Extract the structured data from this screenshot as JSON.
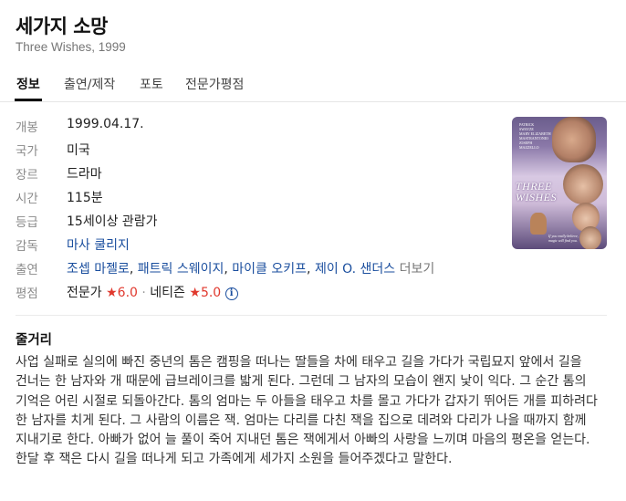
{
  "movie": {
    "title": "세가지 소망",
    "subtitle": "Three Wishes, 1999"
  },
  "tabs": [
    {
      "label": "정보",
      "active": true
    },
    {
      "label": "출연/제작",
      "active": false
    },
    {
      "label": "포토",
      "active": false
    },
    {
      "label": "전문가평점",
      "active": false
    }
  ],
  "info": {
    "release": {
      "label": "개봉",
      "value": "1999.04.17."
    },
    "country": {
      "label": "국가",
      "value": "미국"
    },
    "genre": {
      "label": "장르",
      "value": "드라마"
    },
    "runtime": {
      "label": "시간",
      "value": "115분"
    },
    "rating": {
      "label": "등급",
      "value": "15세이상 관람가"
    },
    "director": {
      "label": "감독",
      "value": "마사 쿨리지"
    },
    "cast": {
      "label": "출연",
      "names": [
        "조셉 마젤로",
        "패트릭 스웨이지",
        "마이클 오키프",
        "제이 O. 샌더스"
      ],
      "separator": ",",
      "more": "더보기"
    },
    "score": {
      "label": "평점",
      "expert_label": "전문가",
      "expert_score": "6.0",
      "dot": "·",
      "netizen_label": "네티즌",
      "netizen_score": "5.0",
      "star_glyph": "★",
      "info_glyph": "i"
    }
  },
  "poster": {
    "names_line1": "PATRICK",
    "names_line2": "SWAYZE",
    "names_line3": "MARY ELIZABETH",
    "names_line4": "MASTRANTONIO",
    "names_line5": "JOSEPH",
    "names_line6": "MAZZELLO",
    "title_line1": "THREE",
    "title_line2": "WISHES",
    "tagline_line1": "If you really believe,",
    "tagline_line2": "magic will find you."
  },
  "synopsis": {
    "heading": "줄거리",
    "text": "사업 실패로 실의에 빠진 중년의 톰은 캠핑을 떠나는 딸들을 차에 태우고 길을 가다가 국립묘지 앞에서 길을 건너는 한 남자와 개 때문에 급브레이크를 밟게 된다. 그런데 그 남자의 모습이 왠지 낯이 익다. 그 순간 톰의 기억은 어린 시절로 되돌아간다. 톰의 엄마는 두 아들을 태우고 차를 몰고 가다가 갑자기 뛰어든 개를 피하려다 한 남자를 치게 된다. 그 사람의 이름은 잭. 엄마는 다리를 다친 잭을 집으로 데려와 다리가 나을 때까지 함께 지내기로 한다. 아빠가 없어 늘 풀이 죽어 지내던 톰은 잭에게서 아빠의 사랑을 느끼며 마음의 평온을 얻는다. 한달 후 잭은 다시 길을 떠나게 되고 가족에게 세가지 소원을 들어주겠다고 말한다."
  },
  "colors": {
    "link": "#1a4e9e",
    "star": "#e0382d",
    "label_gray": "#8a8a8a"
  }
}
